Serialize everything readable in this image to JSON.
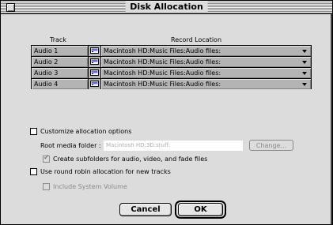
{
  "window": {
    "title": "Disk Allocation"
  },
  "table": {
    "headers": {
      "track": "Track",
      "location": "Record Location"
    },
    "rows": [
      {
        "track": "Audio 1",
        "location": "Macintosh HD:Music Files:Audio files:"
      },
      {
        "track": "Audio 2",
        "location": "Macintosh HD:Music Files:Audio files:"
      },
      {
        "track": "Audio 3",
        "location": "Macintosh HD:Music Files:Audio files:"
      },
      {
        "track": "Audio 4",
        "location": "Macintosh HD:Music Files:Audio files:"
      }
    ],
    "row_icon": "disk-icon"
  },
  "options": {
    "customize_label": "Customize allocation options",
    "customize_checked": false,
    "root_label": "Root media folder :",
    "root_value": "Macintosh HD:3D:stuff:",
    "change_label": "Change...",
    "subfolders_label": "Create subfolders for audio, video, and fade files",
    "subfolders_checked": true,
    "round_robin_label": "Use round robin allocation for new tracks",
    "round_robin_checked": false,
    "system_volume_label": "Include System Volume",
    "system_volume_checked": false
  },
  "buttons": {
    "cancel": "Cancel",
    "ok": "OK"
  }
}
